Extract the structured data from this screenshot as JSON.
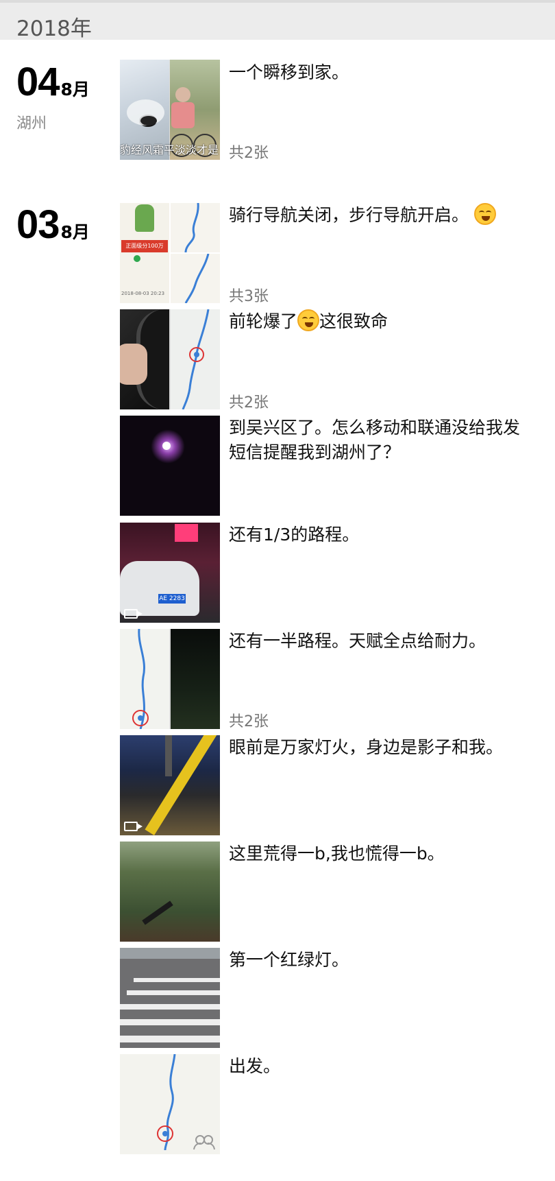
{
  "year": "2018年",
  "days": [
    {
      "day": "04",
      "month": "8月",
      "location": "湖州"
    },
    {
      "day": "03",
      "month": "8月",
      "location": ""
    }
  ],
  "posts": [
    {
      "text": "一个瞬移到家。",
      "count": "共2张",
      "overlay_left": "豹经风霜",
      "overlay_right": "平淡淡才是"
    },
    {
      "text_a": "骑行导航关闭，步行导航开启。",
      "count": "共3张",
      "map_label": "正面级分100万",
      "map_date": "2018-08-03 20:23"
    },
    {
      "text_a": "前轮爆了",
      "text_b": "这很致命",
      "count": "共2张"
    },
    {
      "text": "到吴兴区了。怎么移动和联通没给我发短信提醒我到湖州了？"
    },
    {
      "text": "还有1/3的路程。",
      "plate": "AE 2283",
      "media": "video"
    },
    {
      "text": "还有一半路程。天赋全点给耐力。",
      "count": "共2张"
    },
    {
      "text": "眼前是万家灯火，身边是影子和我。",
      "media": "video"
    },
    {
      "text": "这里荒得一b,我也慌得一b。"
    },
    {
      "text": "第一个红绿灯。"
    },
    {
      "text": "出发。",
      "icon": "shared-frame-icon"
    }
  ],
  "colors": {
    "accent_route": "#3a7fd6",
    "date_gray": "#8a8a8a"
  }
}
